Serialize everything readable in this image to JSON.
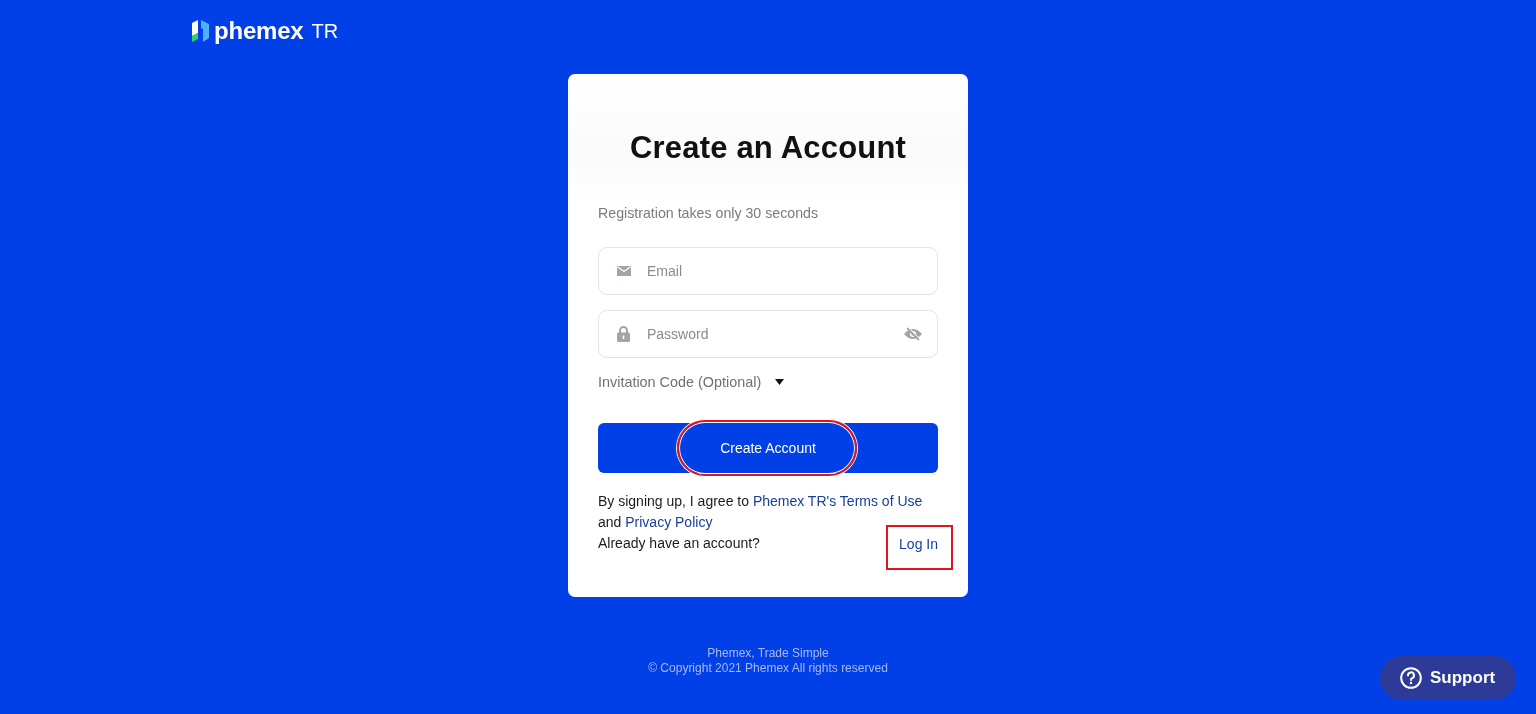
{
  "header": {
    "brand": "phemex",
    "brand_suffix": "TR"
  },
  "card": {
    "title": "Create an Account",
    "subtitle": "Registration takes only 30 seconds",
    "fields": [
      {
        "kind": "email",
        "placeholder": "Email"
      },
      {
        "kind": "password",
        "placeholder": "Password",
        "revealed": false
      }
    ],
    "invitation": {
      "label": "Invitation Code (Optional)",
      "expanded": false
    },
    "submit": {
      "label": "Create Account",
      "highlighted": true
    },
    "terms": [
      {
        "kind": "text",
        "text": "By signing up, I agree to "
      },
      {
        "kind": "link",
        "text": "Phemex TR's Terms of Use"
      },
      {
        "kind": "text",
        "text": " and "
      },
      {
        "kind": "link",
        "text": "Privacy Policy"
      }
    ],
    "login": {
      "prompt": "Already have an account?",
      "link": "Log In",
      "highlighted": true
    }
  },
  "footer": [
    "Phemex, Trade Simple",
    "© Copyright 2021 Phemex All rights reserved"
  ],
  "support": {
    "label": "Support"
  }
}
